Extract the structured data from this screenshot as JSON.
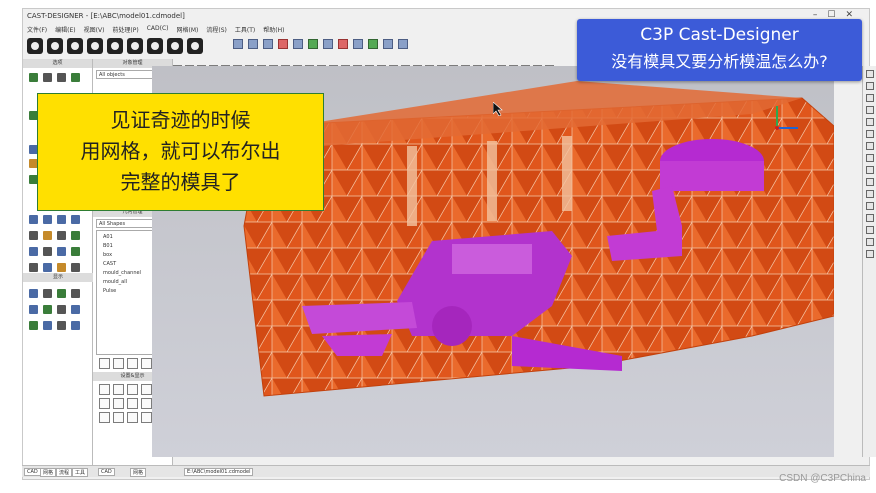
{
  "window": {
    "title": "CAST-DESIGNER - [E:\\ABC\\model01.cdmodel]",
    "menu": [
      "文件(F)",
      "编辑(E)",
      "视图(V)",
      "前处理(P)",
      "CAD(C)",
      "网格(M)",
      "流程(S)",
      "工具(T)",
      "帮助(H)"
    ]
  },
  "left_panel": {
    "header": "选项",
    "sections": [
      "显示"
    ]
  },
  "mid_panel": {
    "header": "对象管理",
    "filter1": "All objects",
    "header2": "几何管理",
    "filter2": "All Shapes",
    "items": [
      "A01",
      "B01",
      "box",
      "CAST",
      "mould_channel",
      "mould_all",
      "Pulse"
    ],
    "header3": "设置&显示"
  },
  "statusbar": {
    "tabs": [
      "CAD",
      "网格",
      "流程",
      "工具"
    ],
    "mid_tabs": [
      "CAD",
      "网格"
    ],
    "file": "E:\\ABC\\model01.cdmodel"
  },
  "banner_top": {
    "line1": "C3P Cast-Designer",
    "line2": "没有模具又要分析模温怎么办?"
  },
  "banner_left": {
    "line1": "见证奇迹的时候",
    "line2": "用网格，就可以布尔出",
    "line3": "完整的模具了"
  },
  "watermark": "CSDN @C3PChina",
  "colors": {
    "mold": "#e0561c",
    "casting": "#c23bd4",
    "banner_blue": "#3c5bd8",
    "banner_yellow": "#ffe000"
  }
}
